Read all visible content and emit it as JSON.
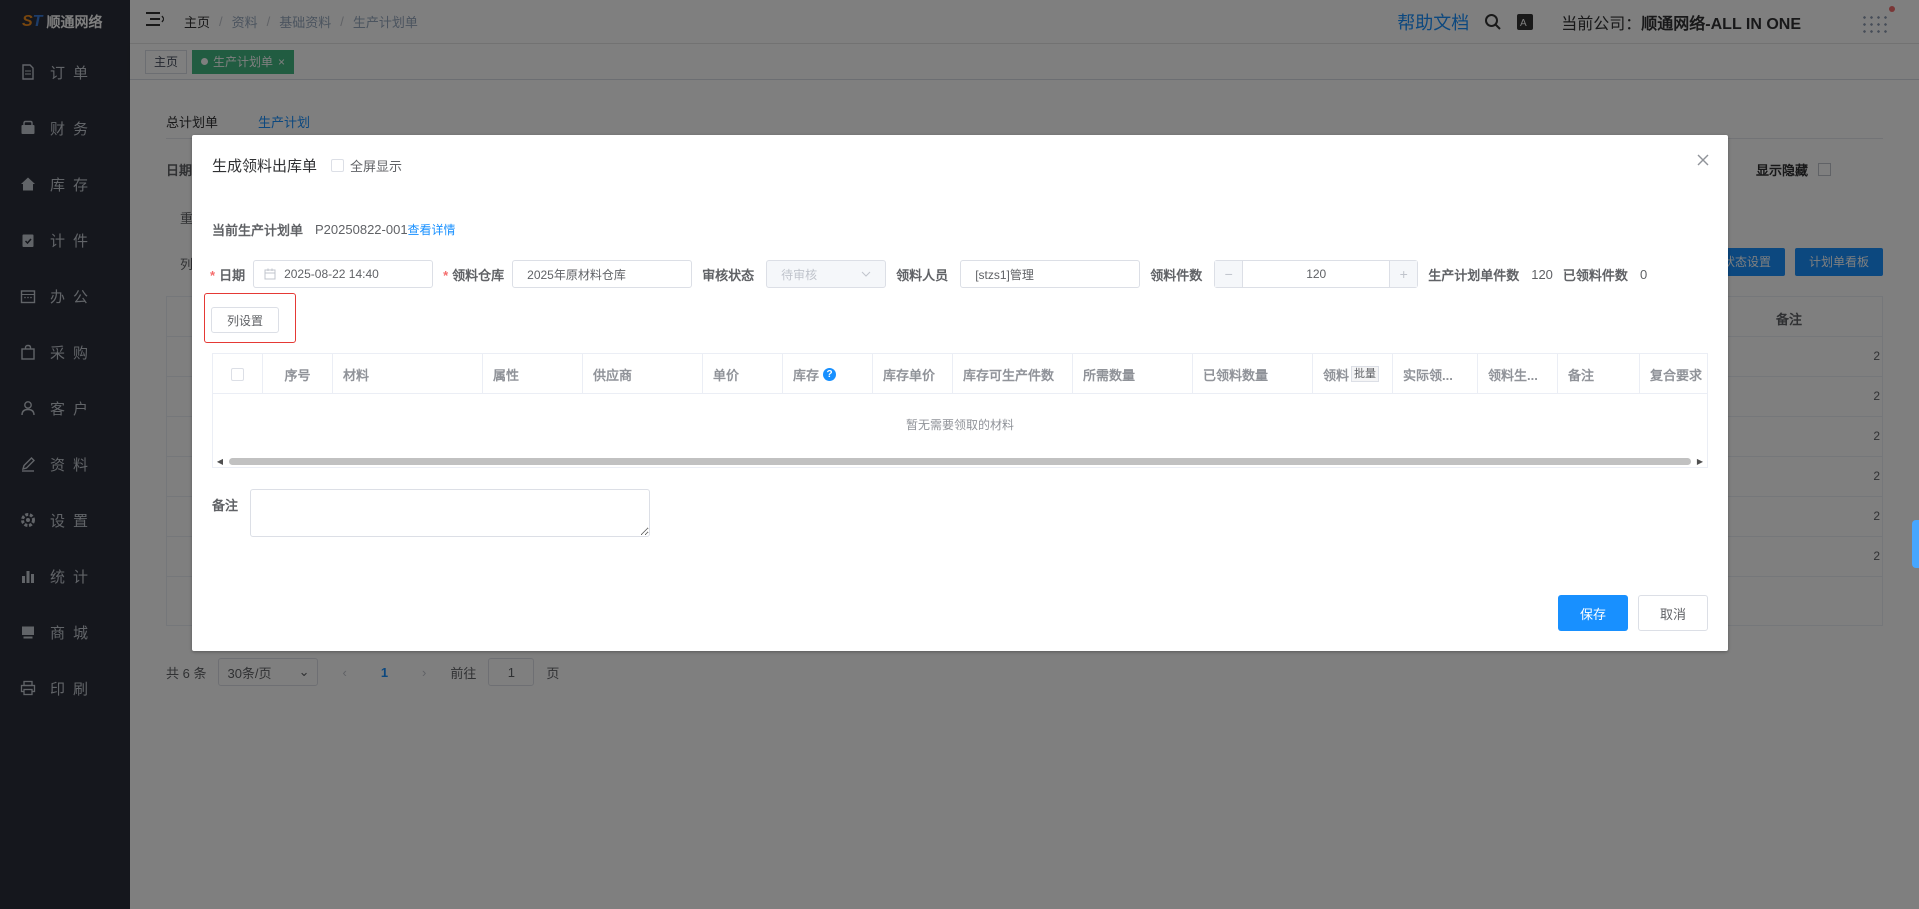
{
  "app": {
    "logo_text": "顺通网络"
  },
  "sidebar": {
    "items": [
      {
        "label": "订单",
        "icon": "document-icon"
      },
      {
        "label": "财务",
        "icon": "wallet-icon"
      },
      {
        "label": "库存",
        "icon": "home-icon"
      },
      {
        "label": "计件",
        "icon": "clipboard-icon"
      },
      {
        "label": "办公",
        "icon": "calendar-icon"
      },
      {
        "label": "采购",
        "icon": "bag-icon"
      },
      {
        "label": "客户",
        "icon": "user-icon"
      },
      {
        "label": "资料",
        "icon": "edit-icon"
      },
      {
        "label": "设置",
        "icon": "gear-icon"
      },
      {
        "label": "统计",
        "icon": "bar-chart-icon"
      },
      {
        "label": "商城",
        "icon": "shop-icon"
      },
      {
        "label": "印刷",
        "icon": "printer-icon"
      }
    ]
  },
  "header": {
    "breadcrumb": [
      "主页",
      "资料",
      "基础资料",
      "生产计划单"
    ],
    "help_label": "帮助文档",
    "company_prefix": "当前公司：",
    "company_name": "顺通网络-ALL IN ONE"
  },
  "tags": {
    "home": "主页",
    "active": "生产计划单",
    "close": "×"
  },
  "page": {
    "subtabs": [
      "总计划单",
      "生产计划"
    ],
    "left_stub_1": "日期",
    "left_stub_2": "重",
    "left_stub_3": "列",
    "show_hidden_label": "显示隐藏",
    "btn_status_settings": "状态设置",
    "btn_plan_board": "计划单看板",
    "col_remark": "备注",
    "row_values": [
      "2",
      "2",
      "2",
      "2",
      "2",
      "2"
    ],
    "pagination": {
      "total": "共 6 条",
      "page_size": "30条/页",
      "current": "1",
      "goto_label": "前往",
      "goto_value": "1",
      "page_unit": "页"
    }
  },
  "dialog": {
    "title": "生成领料出库单",
    "fullscreen_label": "全屏显示",
    "current_plan_label": "当前生产计划单",
    "current_plan_value": "P20250822-001",
    "view_detail_link": "查看详情",
    "form": {
      "date_label": "日期",
      "date_value": "2025-08-22 14:40",
      "warehouse_label": "领料仓库",
      "warehouse_value": "2025年原材料仓库",
      "audit_label": "审核状态",
      "audit_value": "待审核",
      "person_label": "领料人员",
      "person_value": "[stzs1]管理",
      "qty_label": "领料件数",
      "qty_value": "120",
      "plan_qty_label": "生产计划单件数",
      "plan_qty_value": "120",
      "picked_label": "已领料件数",
      "picked_value": "0"
    },
    "column_settings_button": "列设置",
    "table": {
      "columns": [
        "序号",
        "材料",
        "属性",
        "供应商",
        "单价",
        "库存",
        "库存单价",
        "库存可生产件数",
        "所需数量",
        "已领料数量",
        "领料",
        "实际领...",
        "领料生...",
        "备注",
        "复合要求"
      ],
      "batch_badge": "批量",
      "stock_help": "?",
      "empty_text": "暂无需要领取的材料"
    },
    "remark_label": "备注",
    "save_button": "保存",
    "cancel_button": "取消"
  },
  "colors": {
    "primary": "#1890ff",
    "sidebar_bg": "#2b2f3a",
    "active_tag": "#42b983",
    "highlight_border": "#e53935"
  }
}
